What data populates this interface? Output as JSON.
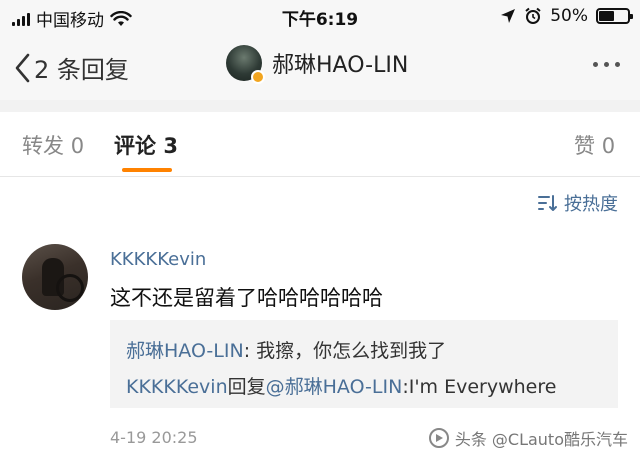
{
  "status_bar": {
    "carrier": "中国移动",
    "time": "下午6:19",
    "battery_percent_label": "50%",
    "battery_level": 0.5
  },
  "nav": {
    "back_label": "2 条回复",
    "user_name": "郝琳HAO-LIN"
  },
  "tabs": [
    {
      "label": "转发",
      "count": "0"
    },
    {
      "label": "评论",
      "count": "3"
    },
    {
      "label": "赞",
      "count": "0"
    }
  ],
  "sort": {
    "label": "按热度"
  },
  "comment": {
    "author": "KKKKKevin",
    "text": "这不还是留着了哈哈哈哈哈哈",
    "time": "4-19 20:25",
    "replies": [
      {
        "author": "郝琳HAO-LIN",
        "text": ": 我擦，你怎么找到我了"
      },
      {
        "author": "KKKKKevin",
        "verb": "回复",
        "mention": "@郝琳HAO-LIN",
        "text": ":I'm Everywhere"
      }
    ]
  },
  "watermark": {
    "text": "头条 @CLauto酷乐汽车"
  },
  "colors": {
    "accent": "#ff8200",
    "link": "#4a6f97",
    "nav_bg": "#f7f7f7",
    "reply_bg": "#f3f3f3"
  }
}
